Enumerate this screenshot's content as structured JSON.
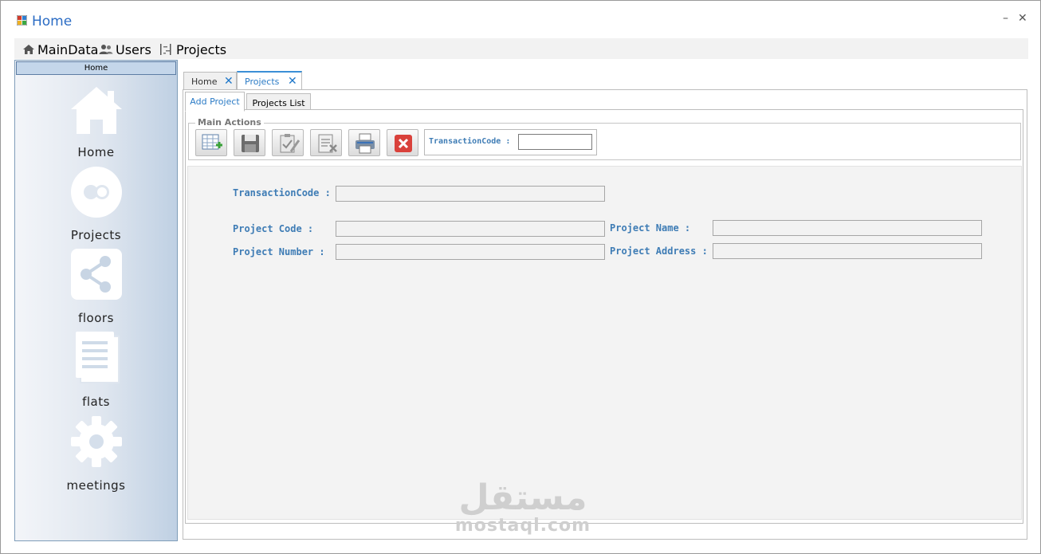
{
  "window": {
    "title": "Home",
    "minimize_label": "–",
    "close_label": "✕"
  },
  "menubar": {
    "items": [
      {
        "label": "MainData",
        "icon": "home-icon"
      },
      {
        "label": "Users",
        "icon": "users-icon"
      },
      {
        "label": "Projects",
        "icon": "tree-icon"
      }
    ]
  },
  "sidebar": {
    "header": "Home",
    "items": [
      {
        "label": "Home",
        "icon": "house-icon"
      },
      {
        "label": "Projects",
        "icon": "circles-icon"
      },
      {
        "label": "floors",
        "icon": "share-icon"
      },
      {
        "label": "flats",
        "icon": "document-stack-icon"
      },
      {
        "label": "meetings",
        "icon": "gear-icon"
      }
    ]
  },
  "doc_tabs": [
    {
      "label": "Home",
      "close": "✕",
      "active": false
    },
    {
      "label": "Projects",
      "close": "✕",
      "active": true
    }
  ],
  "inner_tabs": [
    {
      "label": "Add Project",
      "active": true
    },
    {
      "label": "Projects List",
      "active": false
    }
  ],
  "main_actions": {
    "title": "Main Actions",
    "buttons": [
      "new-grid-icon",
      "save-icon",
      "edit-clipboard-icon",
      "delete-document-icon",
      "print-icon",
      "cancel-icon"
    ],
    "transaction_label": "TransactionCode :",
    "transaction_value": ""
  },
  "form": {
    "transaction_code_label": "TransactionCode :",
    "transaction_code_value": "",
    "project_code_label": "Project Code :",
    "project_code_value": "",
    "project_name_label": "Project Name :",
    "project_name_value": "",
    "project_number_label": "Project Number :",
    "project_number_value": "",
    "project_address_label": "Project Address :",
    "project_address_value": ""
  },
  "watermark": {
    "arabic": "مستقل",
    "latin": "mostaql.com"
  },
  "colors": {
    "accent": "#2b7bc6",
    "label_blue": "#3e7cb5",
    "sidebar_border": "#7f9db9"
  }
}
